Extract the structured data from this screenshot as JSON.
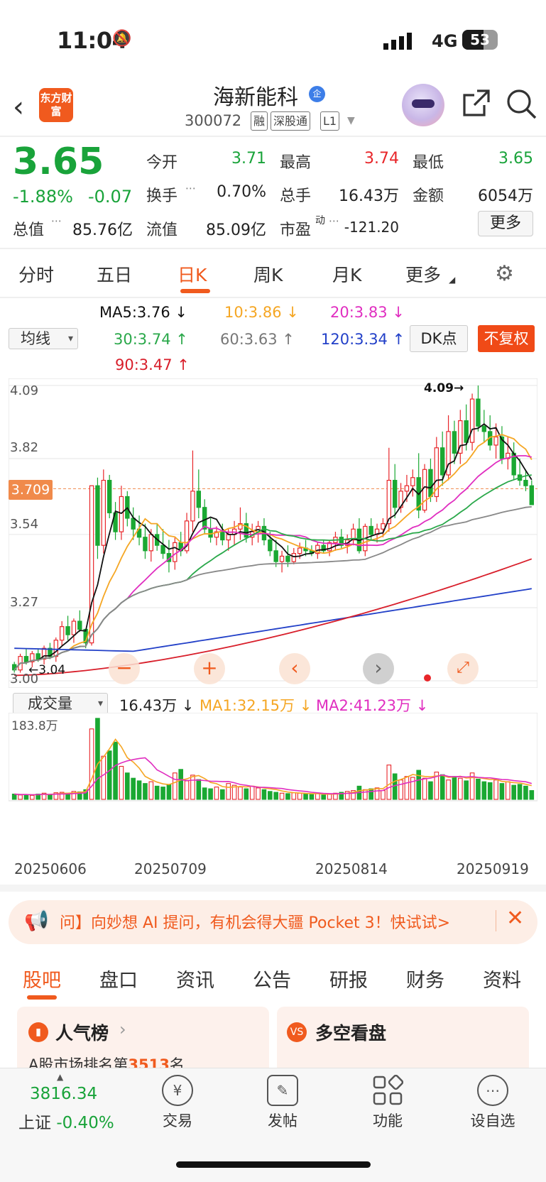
{
  "status_bar": {
    "time": "11:04",
    "network": "4G",
    "battery": "53"
  },
  "header": {
    "back_icon": "chevron-left-icon",
    "logo_text": "东方财富",
    "stock_name": "海新能科",
    "badge": "企",
    "code": "300072",
    "tags": [
      "融",
      "深股通",
      "L1"
    ]
  },
  "quote": {
    "price": "3.65",
    "change_pct": "-1.88%",
    "change": "-0.07",
    "open_label": "今开",
    "open": "3.71",
    "high_label": "最高",
    "high": "3.74",
    "low_label": "最低",
    "low": "3.65",
    "turnover_label": "换手",
    "turnover": "0.70%",
    "volume_label": "总手",
    "volume": "16.43万",
    "amount_label": "金额",
    "amount": "6054万",
    "mktcap_label": "总值",
    "mktcap": "85.76亿",
    "float_label": "流值",
    "float": "85.09亿",
    "pe_label": "市盈",
    "pe_sup": "动",
    "pe": "-121.20",
    "more": "更多"
  },
  "period_tabs": [
    "分时",
    "五日",
    "日K",
    "周K",
    "月K",
    "更多"
  ],
  "active_period": "日K",
  "ma_legend": {
    "selector": "均线",
    "ma5": "MA5:3.76 ↓",
    "ma10": "10:3.86 ↓",
    "ma20": "20:3.83 ↓",
    "ma30": "30:3.74 ↑",
    "ma60": "60:3.63 ↑",
    "ma120": "120:3.34 ↑",
    "ma90": "90:3.47 ↑",
    "dk": "DK点",
    "fq": "不复权"
  },
  "colors": {
    "up": "#e8262a",
    "down": "#1aa832",
    "accent": "#f05a1e",
    "ma5": "#111111",
    "ma10": "#f5a623",
    "ma20": "#e02ec0",
    "ma30": "#2aa84a",
    "ma60": "#888888",
    "ma120": "#2240c8",
    "ma90": "#d81e2a"
  },
  "kchart_labels": {
    "y_ticks": [
      "4.09",
      "3.82",
      "3.54",
      "3.27",
      "3.00"
    ],
    "current": "3.709",
    "max_label": "4.09→",
    "min_label": "←3.04"
  },
  "chart_data": {
    "type": "candlestick",
    "ylim": [
      3.0,
      4.09
    ],
    "max": 4.09,
    "min": 3.04,
    "current_line": 3.709,
    "ohlc": [
      [
        3.06,
        3.07,
        3.03,
        3.04
      ],
      [
        3.04,
        3.1,
        3.03,
        3.09
      ],
      [
        3.09,
        3.12,
        3.06,
        3.07
      ],
      [
        3.07,
        3.11,
        3.05,
        3.1
      ],
      [
        3.1,
        3.12,
        3.07,
        3.08
      ],
      [
        3.08,
        3.13,
        3.06,
        3.12
      ],
      [
        3.12,
        3.14,
        3.08,
        3.09
      ],
      [
        3.09,
        3.16,
        3.07,
        3.15
      ],
      [
        3.15,
        3.22,
        3.13,
        3.2
      ],
      [
        3.2,
        3.24,
        3.15,
        3.17
      ],
      [
        3.17,
        3.23,
        3.14,
        3.22
      ],
      [
        3.22,
        3.26,
        3.18,
        3.19
      ],
      [
        3.19,
        3.16,
        3.12,
        3.14
      ],
      [
        3.14,
        3.72,
        3.13,
        3.72
      ],
      [
        3.72,
        3.75,
        3.45,
        3.5
      ],
      [
        3.5,
        3.78,
        3.47,
        3.74
      ],
      [
        3.74,
        3.76,
        3.6,
        3.62
      ],
      [
        3.62,
        3.66,
        3.52,
        3.55
      ],
      [
        3.55,
        3.72,
        3.52,
        3.68
      ],
      [
        3.68,
        3.7,
        3.57,
        3.6
      ],
      [
        3.6,
        3.64,
        3.52,
        3.56
      ],
      [
        3.56,
        3.61,
        3.5,
        3.53
      ],
      [
        3.53,
        3.58,
        3.45,
        3.48
      ],
      [
        3.48,
        3.56,
        3.44,
        3.54
      ],
      [
        3.54,
        3.58,
        3.48,
        3.5
      ],
      [
        3.5,
        3.56,
        3.45,
        3.47
      ],
      [
        3.47,
        3.52,
        3.4,
        3.44
      ],
      [
        3.44,
        3.53,
        3.41,
        3.51
      ],
      [
        3.51,
        3.55,
        3.46,
        3.48
      ],
      [
        3.48,
        3.62,
        3.47,
        3.59
      ],
      [
        3.59,
        3.85,
        3.55,
        3.7
      ],
      [
        3.7,
        3.78,
        3.6,
        3.64
      ],
      [
        3.64,
        3.67,
        3.54,
        3.56
      ],
      [
        3.56,
        3.6,
        3.51,
        3.53
      ],
      [
        3.53,
        3.57,
        3.5,
        3.55
      ],
      [
        3.55,
        3.58,
        3.5,
        3.52
      ],
      [
        3.52,
        3.56,
        3.48,
        3.54
      ],
      [
        3.54,
        3.59,
        3.5,
        3.56
      ],
      [
        3.56,
        3.64,
        3.52,
        3.58
      ],
      [
        3.58,
        3.62,
        3.51,
        3.53
      ],
      [
        3.53,
        3.58,
        3.5,
        3.55
      ],
      [
        3.55,
        3.59,
        3.51,
        3.57
      ],
      [
        3.57,
        3.6,
        3.5,
        3.52
      ],
      [
        3.52,
        3.55,
        3.46,
        3.48
      ],
      [
        3.48,
        3.52,
        3.42,
        3.44
      ],
      [
        3.44,
        3.48,
        3.4,
        3.46
      ],
      [
        3.46,
        3.5,
        3.42,
        3.44
      ],
      [
        3.44,
        3.49,
        3.43,
        3.47
      ],
      [
        3.47,
        3.51,
        3.45,
        3.49
      ],
      [
        3.49,
        3.52,
        3.46,
        3.48
      ],
      [
        3.48,
        3.5,
        3.46,
        3.47
      ],
      [
        3.47,
        3.51,
        3.45,
        3.5
      ],
      [
        3.5,
        3.52,
        3.47,
        3.48
      ],
      [
        3.48,
        3.52,
        3.46,
        3.51
      ],
      [
        3.51,
        3.55,
        3.48,
        3.53
      ],
      [
        3.53,
        3.56,
        3.49,
        3.5
      ],
      [
        3.5,
        3.54,
        3.47,
        3.52
      ],
      [
        3.52,
        3.58,
        3.5,
        3.56
      ],
      [
        3.56,
        3.6,
        3.47,
        3.48
      ],
      [
        3.48,
        3.58,
        3.46,
        3.57
      ],
      [
        3.57,
        3.6,
        3.52,
        3.54
      ],
      [
        3.54,
        3.58,
        3.51,
        3.56
      ],
      [
        3.56,
        3.6,
        3.53,
        3.58
      ],
      [
        3.58,
        3.86,
        3.55,
        3.74
      ],
      [
        3.74,
        3.8,
        3.6,
        3.64
      ],
      [
        3.64,
        3.73,
        3.62,
        3.7
      ],
      [
        3.7,
        3.76,
        3.66,
        3.72
      ],
      [
        3.72,
        3.78,
        3.68,
        3.75
      ],
      [
        3.75,
        3.84,
        3.6,
        3.63
      ],
      [
        3.63,
        3.8,
        3.62,
        3.78
      ],
      [
        3.78,
        3.82,
        3.66,
        3.68
      ],
      [
        3.68,
        3.9,
        3.66,
        3.86
      ],
      [
        3.86,
        3.92,
        3.72,
        3.76
      ],
      [
        3.76,
        3.98,
        3.74,
        3.92
      ],
      [
        3.92,
        3.96,
        3.8,
        3.84
      ],
      [
        3.84,
        4.0,
        3.8,
        3.96
      ],
      [
        3.96,
        4.02,
        3.85,
        3.88
      ],
      [
        3.88,
        4.06,
        3.85,
        4.04
      ],
      [
        4.04,
        4.09,
        3.92,
        3.94
      ],
      [
        3.94,
        4.0,
        3.88,
        3.92
      ],
      [
        3.92,
        3.98,
        3.85,
        3.87
      ],
      [
        3.87,
        3.95,
        3.82,
        3.9
      ],
      [
        3.9,
        3.94,
        3.8,
        3.82
      ],
      [
        3.82,
        3.9,
        3.78,
        3.84
      ],
      [
        3.84,
        3.88,
        3.74,
        3.76
      ],
      [
        3.76,
        3.82,
        3.72,
        3.74
      ],
      [
        3.74,
        3.78,
        3.7,
        3.72
      ],
      [
        3.72,
        3.74,
        3.65,
        3.65
      ]
    ]
  },
  "volume": {
    "selector": "成交量",
    "value": "16.43万 ↓",
    "ma1": "MA1:32.15万 ↓",
    "ma2": "MA2:41.23万 ↓",
    "max_label": "183.8万",
    "max": 183.8,
    "dates": [
      "20250606",
      "20250709",
      "20250814",
      "20250919"
    ],
    "bars": [
      12,
      10,
      11,
      9,
      12,
      14,
      11,
      15,
      16,
      14,
      18,
      17,
      22,
      160,
      184,
      98,
      110,
      130,
      75,
      60,
      48,
      42,
      36,
      40,
      30,
      28,
      34,
      60,
      68,
      42,
      55,
      45,
      26,
      24,
      28,
      22,
      36,
      32,
      28,
      24,
      30,
      26,
      22,
      18,
      16,
      14,
      13,
      15,
      14,
      12,
      11,
      13,
      10,
      12,
      14,
      16,
      18,
      20,
      30,
      22,
      24,
      26,
      20,
      78,
      58,
      44,
      52,
      50,
      66,
      48,
      40,
      62,
      56,
      44,
      52,
      48,
      42,
      60,
      46,
      40,
      38,
      44,
      36,
      40,
      32,
      34,
      30,
      20
    ]
  },
  "banner": {
    "text": "问】向妙想 AI 提问，有机会得大疆 Pocket 3！快试试>",
    "close": "✕"
  },
  "bottom_tabs": [
    "股吧",
    "盘口",
    "资讯",
    "公告",
    "研报",
    "财务",
    "资料"
  ],
  "cards": [
    {
      "title": "人气榜",
      "sub_prefix": "A股市场排名第",
      "rank": "3513",
      "sub_suffix": "名"
    },
    {
      "title": "多空看盘"
    }
  ],
  "bottom_nav": {
    "index_value": "3816.34",
    "index_name": "上证",
    "index_change": "-0.40%",
    "items": [
      {
        "label": "交易",
        "icon": "yen-icon"
      },
      {
        "label": "发帖",
        "icon": "edit-icon"
      },
      {
        "label": "功能",
        "icon": "grid-icon"
      },
      {
        "label": "设自选",
        "icon": "more-dots-icon"
      }
    ]
  }
}
